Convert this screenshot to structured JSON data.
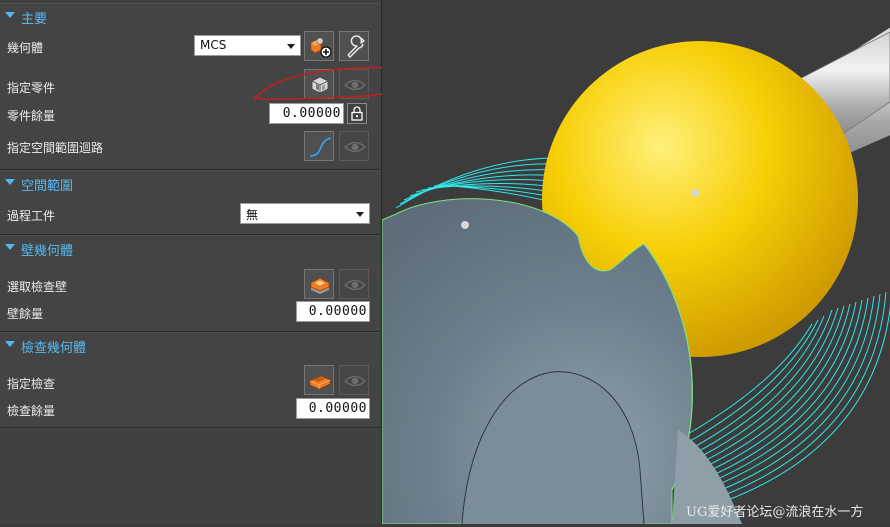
{
  "main_group": {
    "title": "主要",
    "geometry_label": "幾何體",
    "geometry_value": "MCS",
    "part_label": "指定零件",
    "part_stock_label": "零件餘量",
    "part_stock_value": "0.00000",
    "boundary_label": "指定空間範圍迴路"
  },
  "space_group": {
    "title": "空間範圍",
    "ipw_label": "過程工件",
    "ipw_value": "無"
  },
  "wall_group": {
    "title": "壁幾何體",
    "check_wall_label": "選取檢查壁",
    "wall_stock_label": "壁餘量",
    "wall_stock_value": "0.00000"
  },
  "check_group": {
    "title": "檢查幾何體",
    "check_label": "指定檢查",
    "check_stock_label": "檢查餘量",
    "check_stock_value": "0.00000"
  },
  "icons": {
    "new_geometry": "new-geometry-icon",
    "edit": "wrench-icon",
    "specify_part": "part-block-icon",
    "display": "eye-icon",
    "lock": "lock-icon",
    "boundary": "curve-icon",
    "check_wall": "wall-face-icon",
    "check_geometry": "check-body-icon"
  },
  "viewport": {
    "watermark": "UG爱好者论坛@流浪在水一方"
  },
  "colors": {
    "accent": "#57b8ef",
    "annotation": "#c0201c",
    "ball": "#f2c200",
    "workpiece": "#6f8290",
    "toolpath": "#2fe6ea"
  }
}
